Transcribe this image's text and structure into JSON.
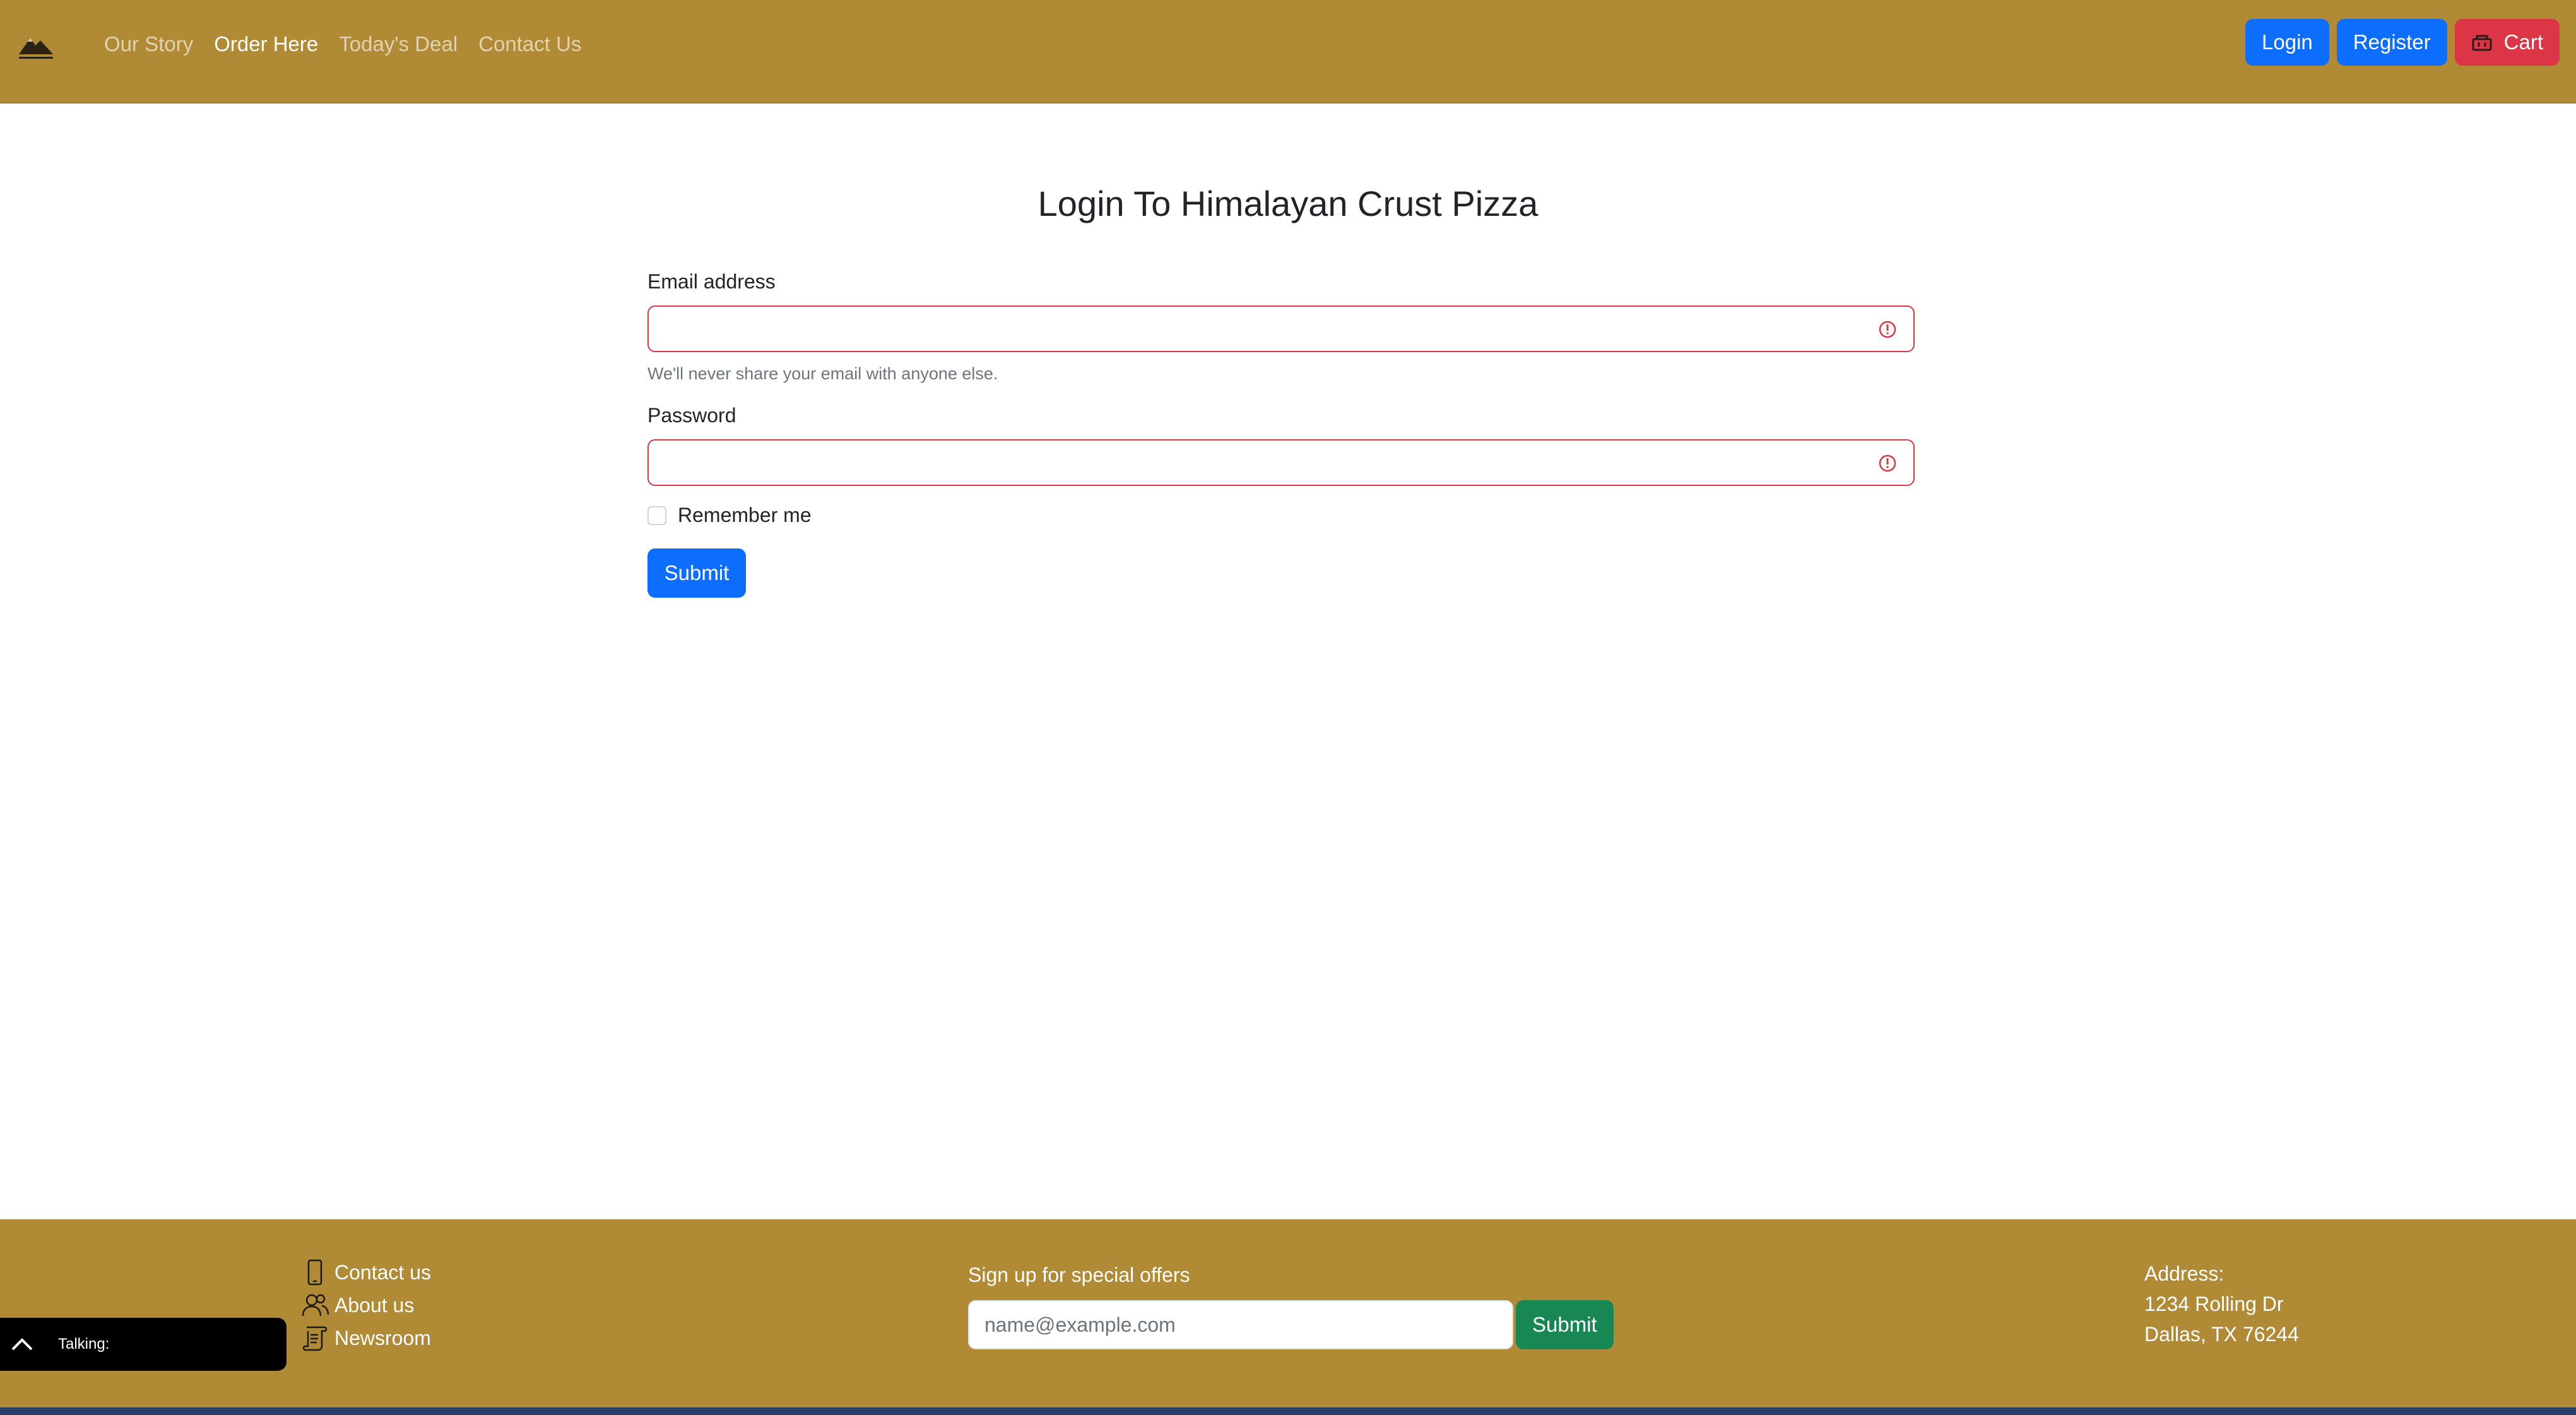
{
  "nav": {
    "links": [
      "Our Story",
      "Order Here",
      "Today's Deal",
      "Contact Us"
    ],
    "active_link": "Order Here",
    "login_label": "Login",
    "register_label": "Register",
    "cart_label": "Cart"
  },
  "form": {
    "title": "Login To Himalayan Crust Pizza",
    "email_label": "Email address",
    "email_value": "",
    "email_help": "We'll never share your email with anyone else.",
    "password_label": "Password",
    "password_value": "",
    "remember_label": "Remember me",
    "submit_label": "Submit"
  },
  "footer": {
    "links": [
      "Contact us",
      "About us",
      "Newsroom"
    ],
    "signup_title": "Sign up for special offers",
    "signup_placeholder": "name@example.com",
    "signup_button": "Submit",
    "address_title": "Address:",
    "address_line1": "1234 Rolling Dr",
    "address_line2": "Dallas, TX 76244"
  },
  "talking_widget": {
    "label": "Talking:"
  },
  "colors": {
    "nav_bg": "#b08a34",
    "primary": "#0d6efd",
    "danger": "#dc3545",
    "success": "#198754"
  },
  "icons": [
    "logo-mountain-icon",
    "cart-icon",
    "error-icon",
    "phone-icon",
    "people-icon",
    "scroll-icon",
    "chevron-up-icon"
  ]
}
